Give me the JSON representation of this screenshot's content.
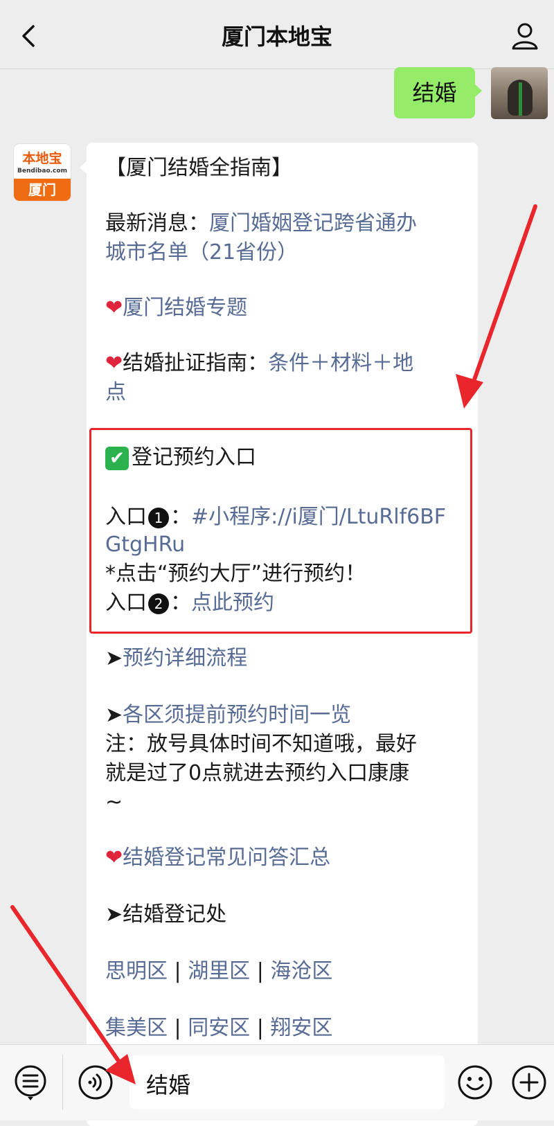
{
  "header": {
    "title": "厦门本地宝"
  },
  "user_message": {
    "text": "结婚"
  },
  "bot_avatar": {
    "logo_text": "本地宝",
    "logo_sub": "Bendibao.com",
    "city": "厦门"
  },
  "message": {
    "title": "【厦门结婚全指南】",
    "latest_label": "最新消息：",
    "latest_link_line1": "厦门婚姻登记跨省通办",
    "latest_link_line2": "城市名单（21省份）",
    "heart": "❤",
    "topic_link": "厦门结婚专题",
    "guide_label": "结婚扯证指南：",
    "guide_link_line1": "条件＋材料＋地",
    "guide_link_line2": "点",
    "check": "✔",
    "register_title": "登记预约入口",
    "entry_label": "入口",
    "entry1_num": "1",
    "colon": "：",
    "entry1_link_line1": "#小程序://i厦门/LtuRlf6BF",
    "entry1_link_line2": "GtgHRu",
    "entry1_note": "*点击“预约大厅”进行预约！",
    "entry2_num": "2",
    "entry2_link": "点此预约",
    "bullet": "➤",
    "process_link": "预约详细流程",
    "advance_link": "各区须提前预约时间一览",
    "note_line1": "注：放号具体时间不知道哦，最好",
    "note_line2": "就是过了0点就进去预约入口康康",
    "note_line3": "~",
    "faq_link": "结婚登记常见问答汇总",
    "office_label": "结婚登记处",
    "sep": " | ",
    "district_row1": [
      "思明区",
      "湖里区",
      "海沧区"
    ],
    "district_row2": [
      "集美区",
      "同安区",
      "翔安区"
    ]
  },
  "input": {
    "value": "结婚"
  },
  "colors": {
    "bubble_green": "#95ec69",
    "link": "#576b95",
    "highlight_red": "#e8262c"
  }
}
